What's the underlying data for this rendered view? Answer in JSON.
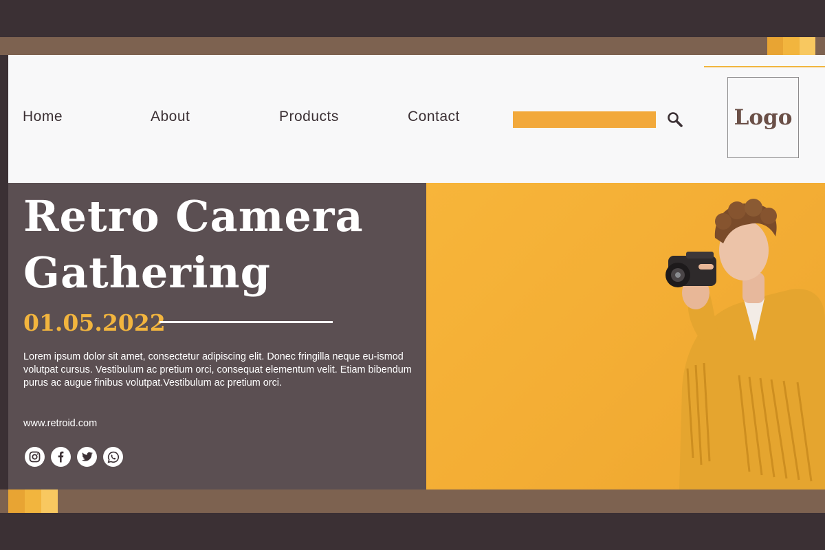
{
  "nav": {
    "items": [
      {
        "label": "Home"
      },
      {
        "label": "About"
      },
      {
        "label": "Products"
      },
      {
        "label": "Contact"
      }
    ]
  },
  "search": {
    "value": "",
    "icon": "search-icon"
  },
  "logo": {
    "text": "Logo"
  },
  "hero": {
    "title_line1": "Retro Camera",
    "title_line2": "Gathering",
    "date": "01.05.2022",
    "description": "Lorem ipsum dolor sit amet, consectetur adipiscing elit. Donec fringilla neque eu-ismod volutpat cursus. Vestibulum ac pretium orci, consequat elementum velit. Etiam bibendum purus ac augue finibus volutpat.Vestibulum ac pretium orci.",
    "website": "www.retroid.com"
  },
  "social": [
    "instagram-icon",
    "facebook-icon",
    "twitter-icon",
    "whatsapp-icon"
  ],
  "colors": {
    "accent": "#f2b53e",
    "dark": "#3b3034",
    "panel": "#5b4f52",
    "band": "#7d6250",
    "header": "#f8f8f9"
  }
}
